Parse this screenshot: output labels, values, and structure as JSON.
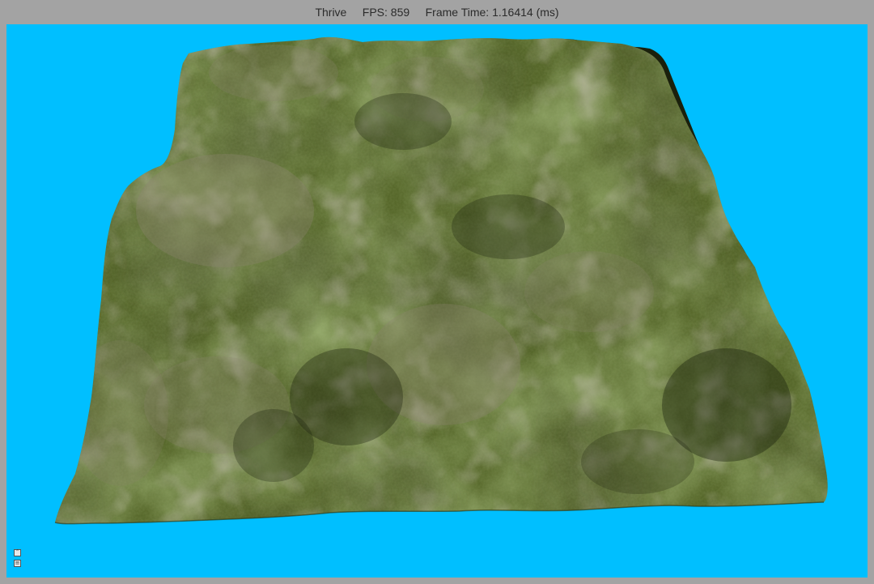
{
  "window": {
    "app_name": "Thrive",
    "fps_text": "FPS: 859",
    "frame_time_text": "Frame Time: 1.16414 (ms)"
  },
  "scene": {
    "sky_color": "#00bfff",
    "terrain_colors": {
      "grass_dark": "#3d4a1f",
      "grass_mid": "#56672a",
      "grass_light": "#6b7d35",
      "rock": "#8b8470",
      "shadow": "#1a200c"
    }
  },
  "overlay": {
    "icons": [
      "profiler-expand-icon",
      "profiler-toggle-icon"
    ]
  }
}
